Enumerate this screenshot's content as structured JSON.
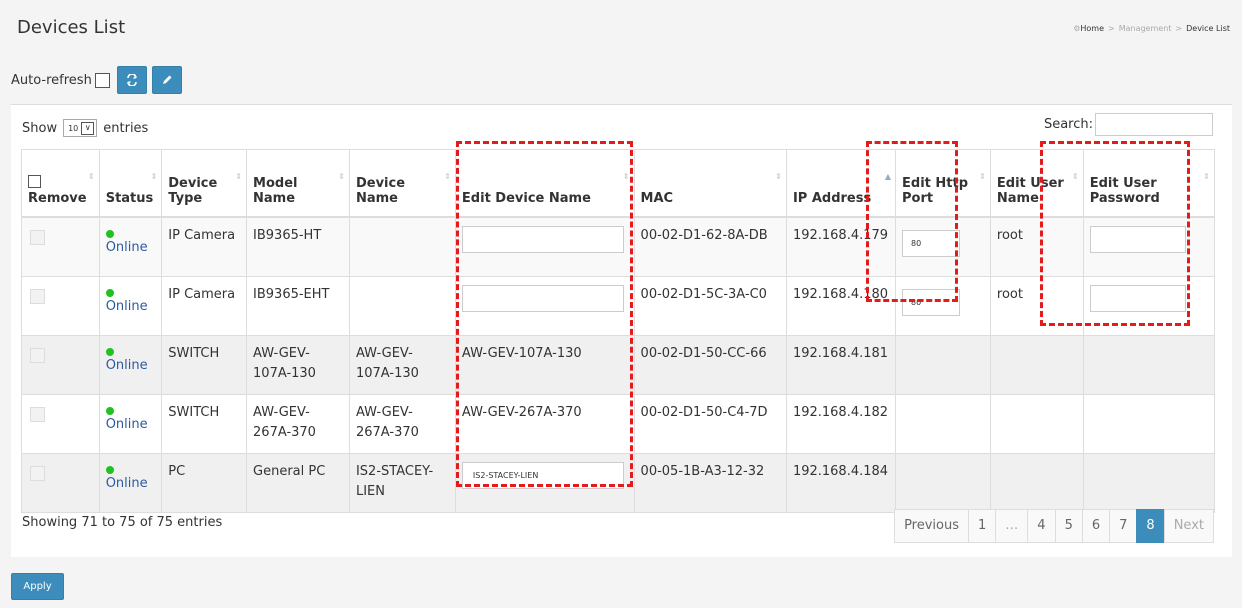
{
  "page": {
    "title": "Devices List",
    "breadcrumb": [
      "Home",
      "Management",
      "Device List"
    ],
    "auto_refresh_label": "Auto-refresh",
    "apply_label": "Apply"
  },
  "controls": {
    "show_label": "Show",
    "page_size": "10",
    "entries_label": "entries",
    "search_label": "Search:",
    "search_value": ""
  },
  "columns": [
    "Remove",
    "Status",
    "Device Type",
    "Model Name",
    "Device Name",
    "Edit Device Name",
    "MAC",
    "IP Address",
    "Edit Http Port",
    "Edit User Name",
    "Edit User Password"
  ],
  "rows": [
    {
      "status": "Online",
      "type": "IP Camera",
      "model": "IB9365-HT",
      "name": "",
      "edit_name": "",
      "mac": "00-02-D1-62-8A-DB",
      "ip": "192.168.4.179",
      "port": "80",
      "user": "root"
    },
    {
      "status": "Online",
      "type": "IP Camera",
      "model": "IB9365-EHT",
      "name": "",
      "edit_name": "",
      "mac": "00-02-D1-5C-3A-C0",
      "ip": "192.168.4.180",
      "port": "80",
      "user": "root"
    },
    {
      "status": "Online",
      "type": "SWITCH",
      "model": "AW-GEV-107A-130",
      "name": "AW-GEV-107A-130",
      "edit_name": "AW-GEV-107A-130",
      "mac": "00-02-D1-50-CC-66",
      "ip": "192.168.4.181",
      "port": "",
      "user": ""
    },
    {
      "status": "Online",
      "type": "SWITCH",
      "model": "AW-GEV-267A-370",
      "name": "AW-GEV-267A-370",
      "edit_name": "AW-GEV-267A-370",
      "mac": "00-02-D1-50-C4-7D",
      "ip": "192.168.4.182",
      "port": "",
      "user": ""
    },
    {
      "status": "Online",
      "type": "PC",
      "model": "General PC",
      "name": "IS2-STACEY-LIEN",
      "edit_name": "IS2-STACEY-LIEN",
      "mac": "00-05-1B-A3-12-32",
      "ip": "192.168.4.184",
      "port": "",
      "user": ""
    }
  ],
  "footer": {
    "info": "Showing 71 to 75 of 75 entries",
    "pagination": [
      "Previous",
      "1",
      "…",
      "4",
      "5",
      "6",
      "7",
      "8",
      "Next"
    ]
  },
  "colors": {
    "accent": "#3c8dbc",
    "online": "#22c122",
    "highlight": "#e31b1b"
  }
}
